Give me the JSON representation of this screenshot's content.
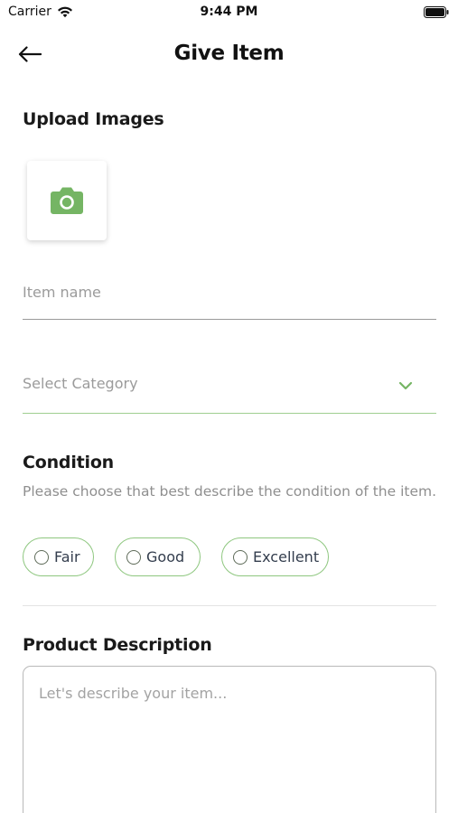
{
  "status_bar": {
    "carrier": "Carrier",
    "time": "9:44 PM"
  },
  "nav": {
    "title": "Give Item",
    "back_icon": "arrow-left-icon"
  },
  "upload": {
    "title": "Upload Images",
    "icon": "camera-icon"
  },
  "form": {
    "item_name_placeholder": "Item name",
    "category_placeholder": "Select Category",
    "category_icon": "chevron-down-icon"
  },
  "condition": {
    "title": "Condition",
    "subtitle": "Please choose that best describe the condition of the item.",
    "options": [
      {
        "label": "Fair",
        "selected": false
      },
      {
        "label": "Good",
        "selected": false
      },
      {
        "label": "Excellent",
        "selected": false
      }
    ]
  },
  "description": {
    "title": "Product Description",
    "placeholder": "Let's describe your item..."
  },
  "colors": {
    "accent": "#75b564",
    "accent_border": "#8ec77f",
    "text_dark": "#1a1a1a",
    "placeholder": "#9b9b9b"
  }
}
